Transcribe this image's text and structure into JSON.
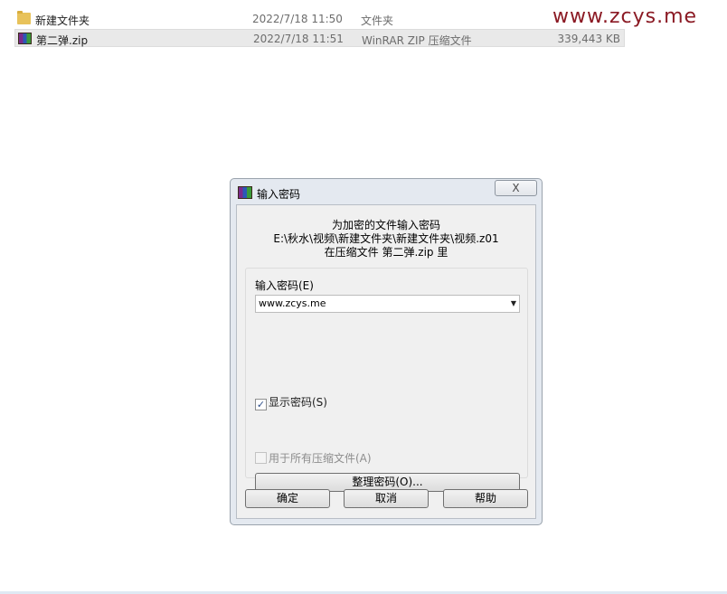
{
  "files": [
    {
      "name": "新建文件夹",
      "date": "2022/7/18 11:50",
      "type": "文件夹",
      "size": "",
      "icon": "folder-icon"
    },
    {
      "name": "第二弹.zip",
      "date": "2022/7/18 11:51",
      "type": "WinRAR ZIP 压缩文件",
      "size": "339,443 KB",
      "icon": "winrar-archive-icon"
    }
  ],
  "watermark": "www.zcys.me",
  "dialog": {
    "title": "输入密码",
    "close_label": "X",
    "info_line1": "为加密的文件输入密码",
    "info_line2": "E:\\秋水\\视频\\新建文件夹\\新建文件夹\\视频.z01",
    "info_line3": "在压缩文件 第二弹.zip 里",
    "password_label": "输入密码(E)",
    "password_value": "www.zcys.me",
    "show_password_label": "显示密码(S)",
    "show_password_checked": true,
    "use_for_all_label": "用于所有压缩文件(A)",
    "use_for_all_checked": false,
    "organize_label": "整理密码(O)...",
    "ok_label": "确定",
    "cancel_label": "取消",
    "help_label": "帮助"
  }
}
